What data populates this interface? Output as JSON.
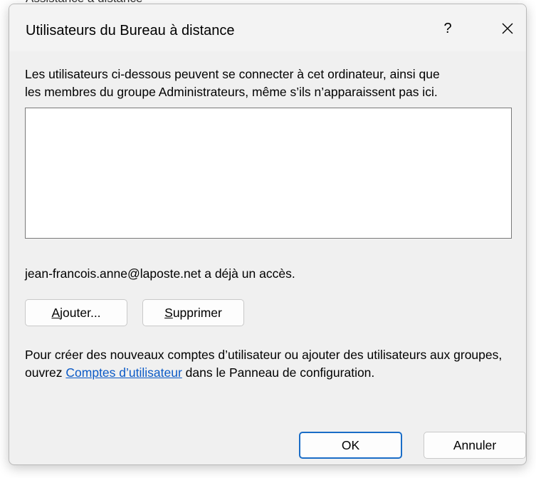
{
  "background": {
    "partial_title": "Assistance à distance"
  },
  "dialog": {
    "title": "Utilisateurs du Bureau à distance",
    "help_label": "?",
    "description_line1": "Les utilisateurs ci-dessous peuvent se connecter à cet ordinateur, ainsi que",
    "description_line2": "les membres du groupe Administrateurs, même s’ils n’apparaissent pas ici.",
    "users": [],
    "access_text": "jean-francois.anne@laposte.net a déjà un accès.",
    "add_button": {
      "mnemonic": "A",
      "rest": "jouter..."
    },
    "remove_button": {
      "mnemonic": "S",
      "rest": "upprimer"
    },
    "info_text_before": "Pour créer des nouveaux comptes d’utilisateur ou ajouter des utilisateurs aux groupes, ouvrez ",
    "info_link": "Comptes d’utilisateur",
    "info_text_after": " dans le Panneau de configuration.",
    "ok_label": "OK",
    "cancel_label": "Annuler",
    "colors": {
      "link": "#0b5ac6",
      "default_button_border": "#1a6dc7",
      "dialog_bg": "#f0f0f0"
    }
  }
}
